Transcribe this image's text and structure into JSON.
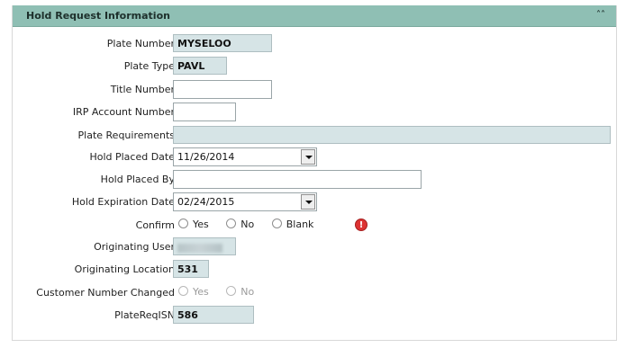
{
  "panel": {
    "title": "Hold Request Information",
    "collapse_icon": "double-chevron-up-icon"
  },
  "fields": {
    "plate_number": {
      "label": "Plate Number",
      "value": "MYSELOO"
    },
    "plate_type": {
      "label": "Plate Type",
      "value": "PAVL"
    },
    "title_number": {
      "label": "Title Number",
      "value": ""
    },
    "irp_account_number": {
      "label": "IRP Account Number",
      "value": ""
    },
    "plate_requirements": {
      "label": "Plate Requirements",
      "value": ""
    },
    "hold_placed_date": {
      "label": "Hold Placed Date",
      "value": "11/26/2014"
    },
    "hold_placed_by": {
      "label": "Hold Placed By",
      "value": ""
    },
    "hold_expiration_date": {
      "label": "Hold Expiration Date",
      "value": "02/24/2015"
    },
    "confirm": {
      "label": "Confirm",
      "options": [
        "Yes",
        "No",
        "Blank"
      ]
    },
    "originating_user": {
      "label": "Originating User"
    },
    "originating_location": {
      "label": "Originating Location",
      "value": "531"
    },
    "customer_number_changed": {
      "label": "Customer Number Changed",
      "options": [
        "Yes",
        "No"
      ]
    },
    "plate_req_isn": {
      "label": "PlateReqISN",
      "value": "586"
    }
  },
  "colors": {
    "header_bg": "#8fbfb4",
    "readonly_bg": "#d6e4e6",
    "warning": "#d33333"
  }
}
